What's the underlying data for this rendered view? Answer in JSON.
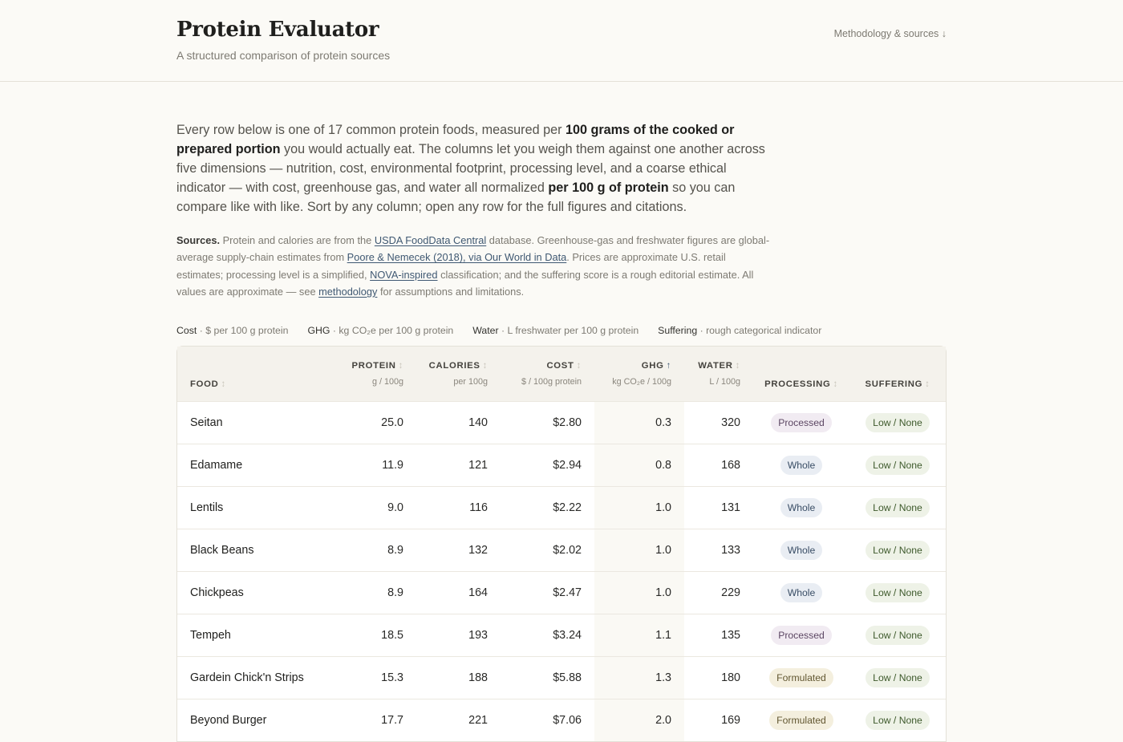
{
  "header": {
    "title": "Protein Evaluator",
    "subtitle": "A structured comparison of protein sources",
    "methodology_link": "Methodology & sources ↓"
  },
  "intro": {
    "p1": "Every row below is one of 17 common protein foods, measured per ",
    "b1": "100 grams of the cooked or prepared portion",
    "p2": " you would actually eat. The columns let you weigh them against one another across five dimensions — nutrition, cost, environmental footprint, processing level, and a coarse ethical indicator — with cost, greenhouse gas, and water all normalized ",
    "b2": "per 100 g of protein",
    "p3": " so you can compare like with like. Sort by any column; open any row for the full figures and citations."
  },
  "sources": {
    "label": "Sources.",
    "t1": " Protein and calories are from the ",
    "link1": "USDA FoodData Central",
    "t2": " database. Greenhouse-gas and freshwater figures are global-average supply-chain estimates from ",
    "link2": "Poore & Nemecek (2018), via Our World in Data",
    "t3": ". Prices are approximate U.S. retail estimates; processing level is a simplified, ",
    "link3": "NOVA-inspired",
    "t4": " classification; and the suffering score is a rough editorial estimate. All values are approximate — see ",
    "link4": "methodology",
    "t5": " for assumptions and limitations."
  },
  "legend": [
    {
      "key": "Cost",
      "desc": " · $ per 100 g protein"
    },
    {
      "key": "GHG",
      "desc": " · kg CO₂e per 100 g protein"
    },
    {
      "key": "Water",
      "desc": " · L freshwater per 100 g protein"
    },
    {
      "key": "Suffering",
      "desc": " · rough categorical indicator"
    }
  ],
  "columns": {
    "food": {
      "label": "FOOD",
      "unit": ""
    },
    "protein": {
      "label": "PROTEIN",
      "unit": "g / 100g"
    },
    "calories": {
      "label": "CALORIES",
      "unit": "per 100g"
    },
    "cost": {
      "label": "COST",
      "unit": "$ / 100g protein"
    },
    "ghg": {
      "label": "GHG",
      "unit": "kg CO₂e / 100g"
    },
    "water": {
      "label": "WATER",
      "unit": "L / 100g"
    },
    "processing": {
      "label": "PROCESSING",
      "unit": ""
    },
    "suffering": {
      "label": "SUFFERING",
      "unit": ""
    },
    "sort_idle": "↕",
    "sort_active": "↑"
  },
  "rows": [
    {
      "food": "Seitan",
      "protein": "25.0",
      "calories": "140",
      "cost": "$2.80",
      "ghg": "0.3",
      "water": "320",
      "processing": "Processed",
      "suffering": "Low / None"
    },
    {
      "food": "Edamame",
      "protein": "11.9",
      "calories": "121",
      "cost": "$2.94",
      "ghg": "0.8",
      "water": "168",
      "processing": "Whole",
      "suffering": "Low / None"
    },
    {
      "food": "Lentils",
      "protein": "9.0",
      "calories": "116",
      "cost": "$2.22",
      "ghg": "1.0",
      "water": "131",
      "processing": "Whole",
      "suffering": "Low / None"
    },
    {
      "food": "Black Beans",
      "protein": "8.9",
      "calories": "132",
      "cost": "$2.02",
      "ghg": "1.0",
      "water": "133",
      "processing": "Whole",
      "suffering": "Low / None"
    },
    {
      "food": "Chickpeas",
      "protein": "8.9",
      "calories": "164",
      "cost": "$2.47",
      "ghg": "1.0",
      "water": "229",
      "processing": "Whole",
      "suffering": "Low / None"
    },
    {
      "food": "Tempeh",
      "protein": "18.5",
      "calories": "193",
      "cost": "$3.24",
      "ghg": "1.1",
      "water": "135",
      "processing": "Processed",
      "suffering": "Low / None"
    },
    {
      "food": "Gardein Chick'n Strips",
      "protein": "15.3",
      "calories": "188",
      "cost": "$5.88",
      "ghg": "1.3",
      "water": "180",
      "processing": "Formulated",
      "suffering": "Low / None"
    },
    {
      "food": "Beyond Burger",
      "protein": "17.7",
      "calories": "221",
      "cost": "$7.06",
      "ghg": "2.0",
      "water": "169",
      "processing": "Formulated",
      "suffering": "Low / None"
    }
  ]
}
